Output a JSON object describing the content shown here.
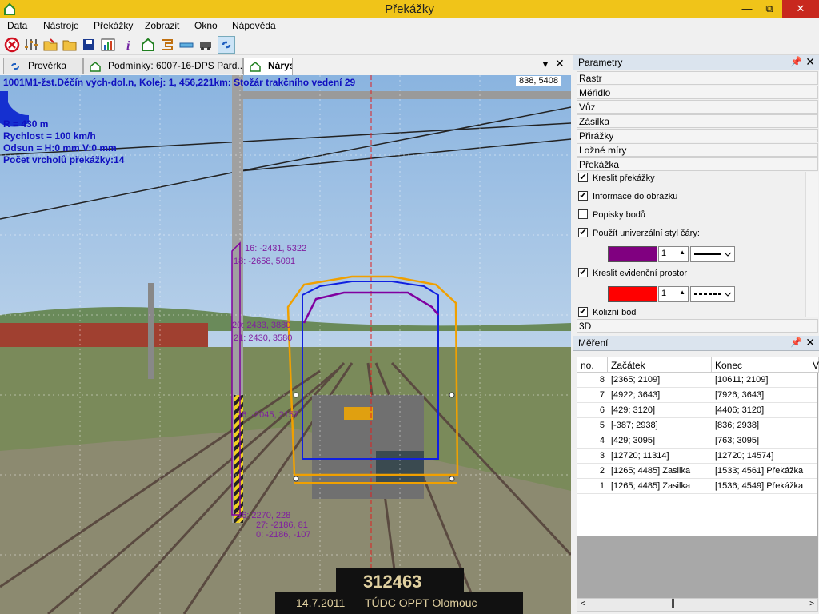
{
  "window": {
    "title": "Překážky"
  },
  "menu": [
    "Data",
    "Nástroje",
    "Překážky",
    "Zobrazit",
    "Okno",
    "Nápověda"
  ],
  "toolbar": [
    "close-circle-icon",
    "sliders-icon",
    "folder-open-icon",
    "folder-icon",
    "save-icon",
    "chart-icon",
    "info-icon",
    "home-icon",
    "track-icon",
    "ruler-icon",
    "wagon-icon",
    "link-icon"
  ],
  "tabs": [
    {
      "label": "Prověrka"
    },
    {
      "label": "Podmínky: 6007-16-DPS Pard..."
    },
    {
      "label": "Nárys"
    }
  ],
  "viewer": {
    "header": "1001M1-žst.Děčín vých-dol.n, Kolej: 1, 456,221km: Stožár trakčního vedení 29",
    "coords": "838, 5408",
    "info": {
      "radius": "R = 430 m",
      "speed": "Rychlost = 100 km/h",
      "offset": "Odsun = H:0 mm V:0 mm",
      "vertices": "Počet vrcholů překážky:14"
    },
    "labels": {
      "p1": "16: -2431, 5322",
      "p2": "18: -2658, 5091",
      "p3": "20: 2433, 3880",
      "p4": "21: 2430, 3580",
      "p5": "26: -2045, 2157",
      "p6": "26: 2270, 228",
      "p7": "27: -2186, 81",
      "p8": "0: -2186, -107"
    },
    "car_number": "312463",
    "date": "14.7.2011",
    "org": "TÚDC OPPT Olomouc",
    "colors": {
      "profile": "#f0a000",
      "gauge": "#1020e0",
      "obstacle": "#8000a0",
      "axis": "#e02020"
    }
  },
  "params": {
    "title": "Parametry",
    "sections": [
      "Rastr",
      "Měřidlo",
      "Vůz",
      "Zásilka",
      "Přirážky",
      "Ložné míry",
      "Překážka"
    ],
    "options": {
      "draw_obstacles": "Kreslit překážky",
      "info_image": "Informace do obrázku",
      "point_labels": "Popisky bodů",
      "universal_style": "Použít univerzální styl čáry:",
      "draw_space": "Kreslit evidenční prostor",
      "collision": "Kolizní bod"
    },
    "checks": {
      "draw_obstacles": true,
      "info_image": true,
      "point_labels": false,
      "universal_style": true,
      "draw_space": true,
      "collision": true
    },
    "style1": {
      "color": "#800080",
      "width": "1"
    },
    "style2": {
      "color": "#ff0000",
      "width": "1"
    },
    "section_3d": "3D"
  },
  "measure": {
    "title": "Měření",
    "columns": [
      "no.",
      "Začátek",
      "Konec",
      "V"
    ],
    "rows": [
      {
        "no": "8",
        "start": "[2365; 2109]",
        "end": "[10611; 2109]"
      },
      {
        "no": "7",
        "start": "[4922; 3643]",
        "end": "[7926; 3643]"
      },
      {
        "no": "6",
        "start": "[429; 3120]",
        "end": "[4406; 3120]"
      },
      {
        "no": "5",
        "start": "[-387; 2938]",
        "end": "[836; 2938]"
      },
      {
        "no": "4",
        "start": "[429; 3095]",
        "end": "[763; 3095]"
      },
      {
        "no": "3",
        "start": "[12720; 11314]",
        "end": "[12720; 14574]"
      },
      {
        "no": "2",
        "start": "[1265; 4485] Zasilka",
        "end": "[1533; 4561] Překážka"
      },
      {
        "no": "1",
        "start": "[1265; 4485] Zasilka",
        "end": "[1536; 4549] Překážka"
      }
    ]
  }
}
